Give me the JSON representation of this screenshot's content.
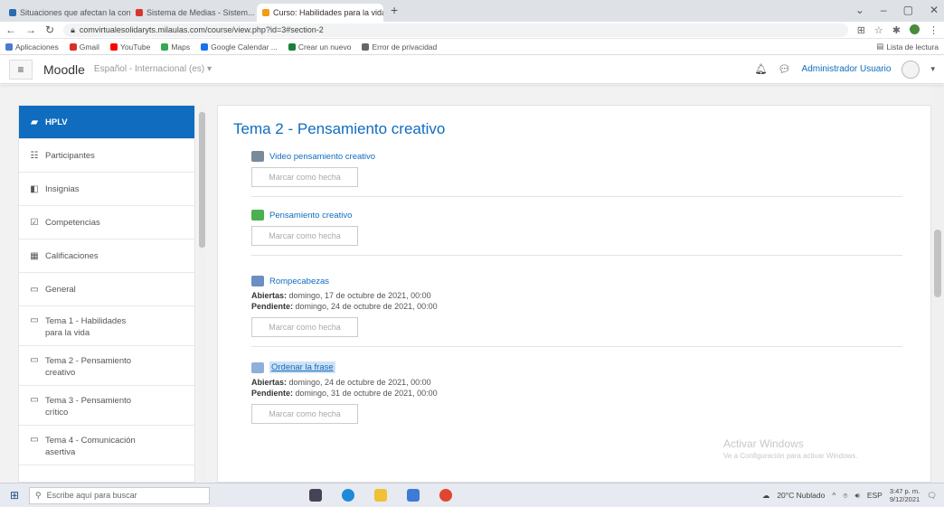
{
  "browser": {
    "tabs": [
      {
        "title": "Situaciones que afectan la convi...",
        "active": false,
        "color": "#2b6cb0"
      },
      {
        "title": "Sistema de Medias - Sistem...",
        "active": false,
        "color": "#d9362b"
      },
      {
        "title": "Curso: Habilidades para la vida",
        "active": true,
        "color": "#f39c12"
      }
    ],
    "new_tab": "+",
    "window_controls": [
      "⌄",
      "–",
      "▢",
      "✕"
    ],
    "url": "comvirtualesolidaryts.milaulas.com/course/view.php?id=3#section-2",
    "bookmarks": [
      {
        "label": "Aplicaciones",
        "color": "#4a7bd0"
      },
      {
        "label": "Gmail",
        "color": "#d93025"
      },
      {
        "label": "YouTube",
        "color": "#ff0000"
      },
      {
        "label": "Maps",
        "color": "#34a853"
      },
      {
        "label": "Google Calendar ...",
        "color": "#1a73e8"
      },
      {
        "label": "Crear un nuevo",
        "color": "#188038"
      },
      {
        "label": "Error de privacidad",
        "color": "#666666"
      }
    ],
    "reading_list": "Lista de lectura"
  },
  "moodle": {
    "brand": "Moodle",
    "language": "Español - Internacional (es) ▾",
    "user": "Administrador Usuario",
    "accent": "#0f6cbf"
  },
  "drawer": {
    "items": [
      {
        "label": "HPLV",
        "icon": "▰"
      },
      {
        "label": "Participantes",
        "icon": "☷"
      },
      {
        "label": "Insignias",
        "icon": "◧"
      },
      {
        "label": "Competencias",
        "icon": "☑"
      },
      {
        "label": "Calificaciones",
        "icon": "▦"
      },
      {
        "label": "General",
        "icon": "▭"
      },
      {
        "label": "Tema 1 - Habilidades para la vida",
        "icon": "▭"
      },
      {
        "label": "Tema 2 - Pensamiento creativo",
        "icon": "▭"
      },
      {
        "label": "Tema 3 - Pensamiento crítico",
        "icon": "▭"
      },
      {
        "label": "Tema 4 - Comunicación asertiva",
        "icon": "▭"
      }
    ]
  },
  "section": {
    "title": "Tema 2 - Pensamiento creativo",
    "mark_label": "Marcar como hecha",
    "activities": [
      {
        "name": "Video pensamiento creativo",
        "icon_color": "#7a8a9a",
        "opened": "",
        "due": ""
      },
      {
        "name": "Pensamiento creativo",
        "icon_color": "#4caf50",
        "opened": "",
        "due": ""
      },
      {
        "name": "Rompecabezas",
        "icon_color": "#6b8fc4",
        "opened": "domingo, 17 de octubre de 2021, 00:00",
        "due": "domingo, 24 de octubre de 2021, 00:00"
      },
      {
        "name": "Ordenar la frase",
        "icon_color": "#8fb0d8",
        "opened": "domingo, 24 de octubre de 2021, 00:00",
        "due": "domingo, 31 de octubre de 2021, 00:00"
      }
    ],
    "opened_label": "Abiertas:",
    "due_label": "Pendiente:"
  },
  "watermark": {
    "title": "Activar Windows",
    "subtitle": "Ve a Configuración para activar Windows."
  },
  "taskbar": {
    "search_placeholder": "Escribe aquí para buscar",
    "weather": "20°C Nublado",
    "lang": "ESP",
    "time": "3:47 p. m.",
    "date": "9/12/2021"
  }
}
